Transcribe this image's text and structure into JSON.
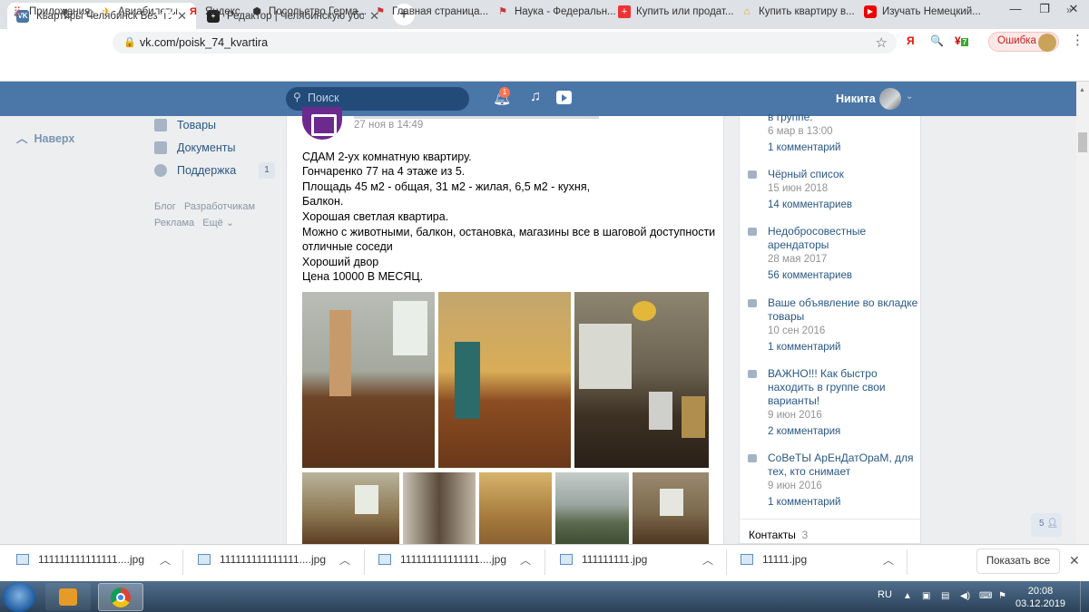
{
  "browser": {
    "tabs": [
      {
        "title": "Квартиры Челябинск Без посре",
        "active": true,
        "favicon": "vk-icon"
      },
      {
        "title": "Редактор | Челябинскую убоже",
        "active": false,
        "favicon": "plus-square-icon"
      }
    ],
    "url": "vk.com/poisk_74_kvartira",
    "error_button": "Ошибка",
    "ext_badge": "7",
    "bookmarks": [
      {
        "label": "Приложения",
        "icon": "apps-grid-icon"
      },
      {
        "label": "Авиабилеты",
        "icon": "plane-icon"
      },
      {
        "label": "Яндекс",
        "icon": "yandex-icon"
      },
      {
        "label": "Посольство Герма...",
        "icon": "cube-icon"
      },
      {
        "label": "Главная страница...",
        "icon": "flag-icon"
      },
      {
        "label": "Наука - Федеральн...",
        "icon": "flag-icon"
      },
      {
        "label": "Купить или продат...",
        "icon": "plus-red-icon"
      },
      {
        "label": "Купить квартиру в...",
        "icon": "house-icon"
      },
      {
        "label": "Изучать Немецкий...",
        "icon": "youtube-icon"
      }
    ]
  },
  "vk": {
    "search_placeholder": "Поиск",
    "notifications": "1",
    "user_name": "Никита",
    "back_to_top": "Наверх",
    "menu": [
      {
        "label": "Товары",
        "count": ""
      },
      {
        "label": "Документы",
        "count": ""
      },
      {
        "label": "Поддержка",
        "count": "1"
      }
    ],
    "footer_links": [
      "Блог",
      "Разработчикам",
      "Реклама",
      "Ещё"
    ],
    "post": {
      "date": "27 ноя в 14:49",
      "lines": [
        "СДАМ 2-ух комнатную квартиру.",
        "Гончаренко 77 на 4 этаже из 5.",
        "Площадь 45 м2 - общая, 31 м2 - жилая, 6,5 м2 - кухня,",
        "Балкон.",
        "Хорошая светлая квартира.",
        "Можно с животными, балкон, остановка, магазины все в шаговой доступности",
        "отличные соседи",
        "Хороший двор",
        "Цена 10000 В МЕСЯЦ."
      ]
    },
    "discussions": [
      {
        "title": [
          "в группе."
        ],
        "date": "6 мар в 13:00",
        "comments": "1 комментарий"
      },
      {
        "title": [
          "Чёрный список"
        ],
        "date": "15 июн 2018",
        "comments": "14 комментариев"
      },
      {
        "title": [
          "Недобросовестные",
          "арендаторы"
        ],
        "date": "28 мая 2017",
        "comments": "56 комментариев"
      },
      {
        "title": [
          "Ваше объявление во вкладке",
          "товары"
        ],
        "date": "10 сен 2016",
        "comments": "1 комментарий"
      },
      {
        "title": [
          "ВАЖНО!!! Как быстро",
          "находить в группе свои",
          "варианты!"
        ],
        "date": "9 июн 2016",
        "comments": "2 комментария"
      },
      {
        "title": [
          "СоВеТЫ АрЕнДатОраМ, для",
          "тех, кто снимает"
        ],
        "date": "9 июн 2016",
        "comments": "1 комментарий"
      }
    ],
    "contacts_label": "Контакты",
    "contacts_count": "3",
    "online_count": "5"
  },
  "downloads": {
    "items": [
      "111111111111111....jpg",
      "111111111111111....jpg",
      "111111111111111....jpg",
      "111111111.jpg",
      "11111.jpg"
    ],
    "show_all": "Показать все"
  },
  "taskbar": {
    "lang": "RU",
    "time": "20:08",
    "date": "03.12.2019"
  }
}
